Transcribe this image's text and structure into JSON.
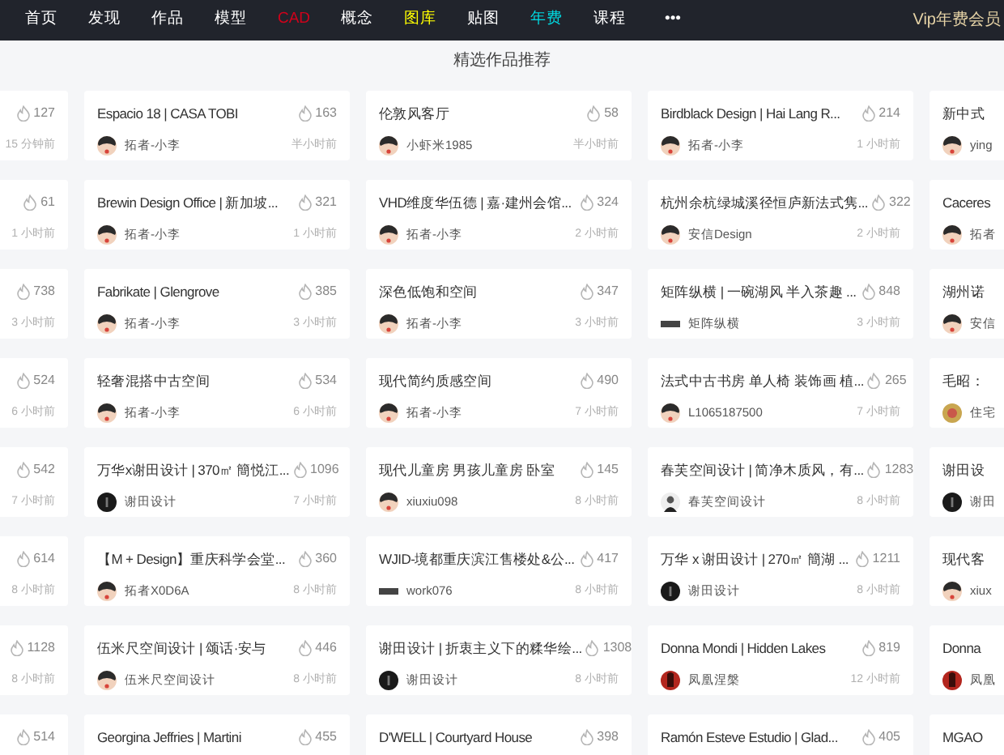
{
  "nav": {
    "items": [
      {
        "label": "首页",
        "color": "#ffffff"
      },
      {
        "label": "发现",
        "color": "#ffffff"
      },
      {
        "label": "作品",
        "color": "#ffffff"
      },
      {
        "label": "模型",
        "color": "#ffffff"
      },
      {
        "label": "CAD",
        "color": "#d0021b"
      },
      {
        "label": "概念",
        "color": "#ffffff"
      },
      {
        "label": "图库",
        "color": "#ffff00"
      },
      {
        "label": "贴图",
        "color": "#ffffff"
      },
      {
        "label": "年费",
        "color": "#00d8e0"
      },
      {
        "label": "课程",
        "color": "#ffffff"
      },
      {
        "label": "•••",
        "color": "#ffffff"
      }
    ],
    "vip": "Vip年费会员"
  },
  "section_title": "精选作品推荐",
  "rows": [
    [
      {
        "views": "127",
        "time": "15 分钟前"
      },
      {
        "title": "Espacio 18 | CASA TOBI",
        "views": "163",
        "author": "拓者-小李",
        "time": "半小时前",
        "kind": "cartoon"
      },
      {
        "title": "伦敦风客厅",
        "views": "58",
        "author": "小虾米1985",
        "time": "半小时前",
        "kind": "cartoon"
      },
      {
        "title": "Birdblack Design | Hai Lang R...",
        "views": "214",
        "author": "拓者-小李",
        "time": "1 小时前",
        "kind": "cartoon"
      },
      {
        "title": "新中式",
        "author": "ying",
        "kind": "cartoon"
      }
    ],
    [
      {
        "views": "61",
        "time": "1 小时前"
      },
      {
        "title": "Brewin Design Office | 新加坡...",
        "views": "321",
        "author": "拓者-小李",
        "time": "1 小时前",
        "kind": "cartoon"
      },
      {
        "title": "VHD维度华伍德 | 嘉·建州会馆...",
        "views": "324",
        "author": "拓者-小李",
        "time": "2 小时前",
        "kind": "cartoon"
      },
      {
        "title": "杭州余杭绿城溪径恒庐新法式隽...",
        "views": "322",
        "author": "安信Design",
        "time": "2 小时前",
        "kind": "cartoon"
      },
      {
        "title": "Caceres",
        "author": "拓者",
        "kind": "cartoon"
      }
    ],
    [
      {
        "views": "738",
        "time": "3 小时前"
      },
      {
        "title": "Fabrikate | Glengrove",
        "views": "385",
        "author": "拓者-小李",
        "time": "3 小时前",
        "kind": "cartoon"
      },
      {
        "title": "深色低饱和空间",
        "views": "347",
        "author": "拓者-小李",
        "time": "3 小时前",
        "kind": "cartoon"
      },
      {
        "title": "矩阵纵横 | 一碗湖风 半入茶趣 ...",
        "views": "848",
        "author": "矩阵纵横",
        "time": "3 小时前",
        "kind": "logo"
      },
      {
        "title": "湖州诺",
        "author": "安信",
        "kind": "cartoon"
      }
    ],
    [
      {
        "views": "524",
        "time": "6 小时前"
      },
      {
        "title": "轻奢混搭中古空间",
        "views": "534",
        "author": "拓者-小李",
        "time": "6 小时前",
        "kind": "cartoon"
      },
      {
        "title": "现代简约质感空间",
        "views": "490",
        "author": "拓者-小李",
        "time": "7 小时前",
        "kind": "cartoon"
      },
      {
        "title": "法式中古书房 单人椅 装饰画 植...",
        "views": "265",
        "author": "L1065187500",
        "time": "7 小时前",
        "kind": "cartoon"
      },
      {
        "title": "毛昭：",
        "author": "住宅",
        "kind": "photo"
      }
    ],
    [
      {
        "views": "542",
        "time": "7 小时前"
      },
      {
        "title": "万华x谢田设计 | 370㎡ 簡悦江...",
        "views": "1096",
        "author": "谢田设计",
        "time": "7 小时前",
        "kind": "dark"
      },
      {
        "title": "现代儿童房 男孩儿童房 卧室",
        "views": "145",
        "author": "xiuxiu098",
        "time": "8 小时前",
        "kind": "cartoon"
      },
      {
        "title": "春芙空间设计 | 简净木质风，有...",
        "views": "1283",
        "author": "春芙空间设计",
        "time": "8 小时前",
        "kind": "person"
      },
      {
        "title": "谢田设",
        "author": "谢田",
        "kind": "dark"
      }
    ],
    [
      {
        "views": "614",
        "time": "8 小时前"
      },
      {
        "title": "【M + Design】重庆科学会堂...",
        "views": "360",
        "author": "拓者X0D6A",
        "time": "8 小时前",
        "kind": "cartoon"
      },
      {
        "title": "WJID-境都重庆滨江售楼处&公...",
        "views": "417",
        "author": "work076",
        "time": "8 小时前",
        "kind": "logo"
      },
      {
        "title": "万华 x 谢田设计 | 270㎡ 簡湖 ...",
        "views": "1211",
        "author": "谢田设计",
        "time": "8 小时前",
        "kind": "dark"
      },
      {
        "title": "现代客",
        "author": "xiux",
        "kind": "cartoon"
      }
    ],
    [
      {
        "views": "1128",
        "time": "8 小时前"
      },
      {
        "title": "伍米尺空间设计 | 颂话·安与",
        "views": "446",
        "author": "伍米尺空间设计",
        "time": "8 小时前",
        "kind": "cartoon"
      },
      {
        "title": "谢田设计 | 折衷主义下的糅华绘...",
        "views": "1308",
        "author": "谢田设计",
        "time": "8 小时前",
        "kind": "dark"
      },
      {
        "title": "Donna Mondi | Hidden Lakes",
        "views": "819",
        "author": "凤凰涅槃",
        "time": "12 小时前",
        "kind": "red"
      },
      {
        "title": "Donna",
        "author": "凤凰",
        "kind": "red"
      }
    ],
    [
      {
        "views": "514"
      },
      {
        "title": "Georgina Jeffries | Martini",
        "views": "455"
      },
      {
        "title": "D'WELL | Courtyard House",
        "views": "398"
      },
      {
        "title": "Ramón Esteve Estudio | Glad...",
        "views": "405"
      },
      {
        "title": "MGAO"
      }
    ]
  ]
}
